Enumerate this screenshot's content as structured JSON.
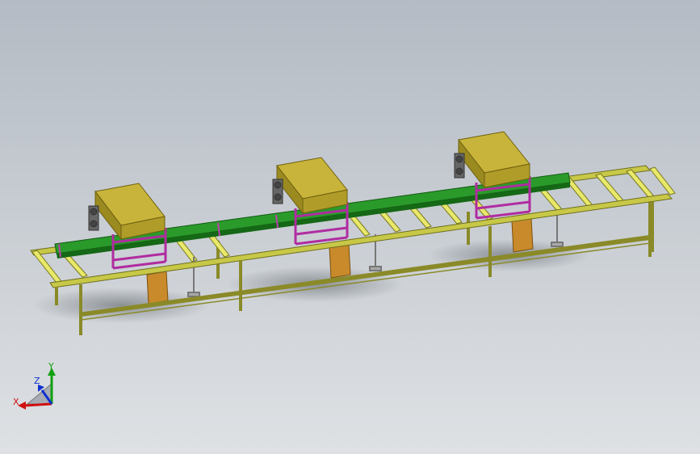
{
  "viewport": {
    "background_top": "#b4bbc4",
    "background_bottom": "#dee1e4"
  },
  "model": {
    "frame_color": "#b4b43c",
    "frame_dark": "#6e6e1e",
    "roller_color": "#e8e86a",
    "beam_color": "#1f8a1f",
    "beam_dark": "#125a12",
    "machine_box_color": "#b0a02a",
    "machine_frame_color": "#d040c0",
    "support_block_color": "#c88a2a",
    "leg_jack_color": "#9a9a9a",
    "stations": 3
  },
  "triad": {
    "x_label": "X",
    "y_label": "Y",
    "z_label": "Z",
    "x_color": "#d01010",
    "y_color": "#10a010",
    "z_color": "#1030d0"
  }
}
